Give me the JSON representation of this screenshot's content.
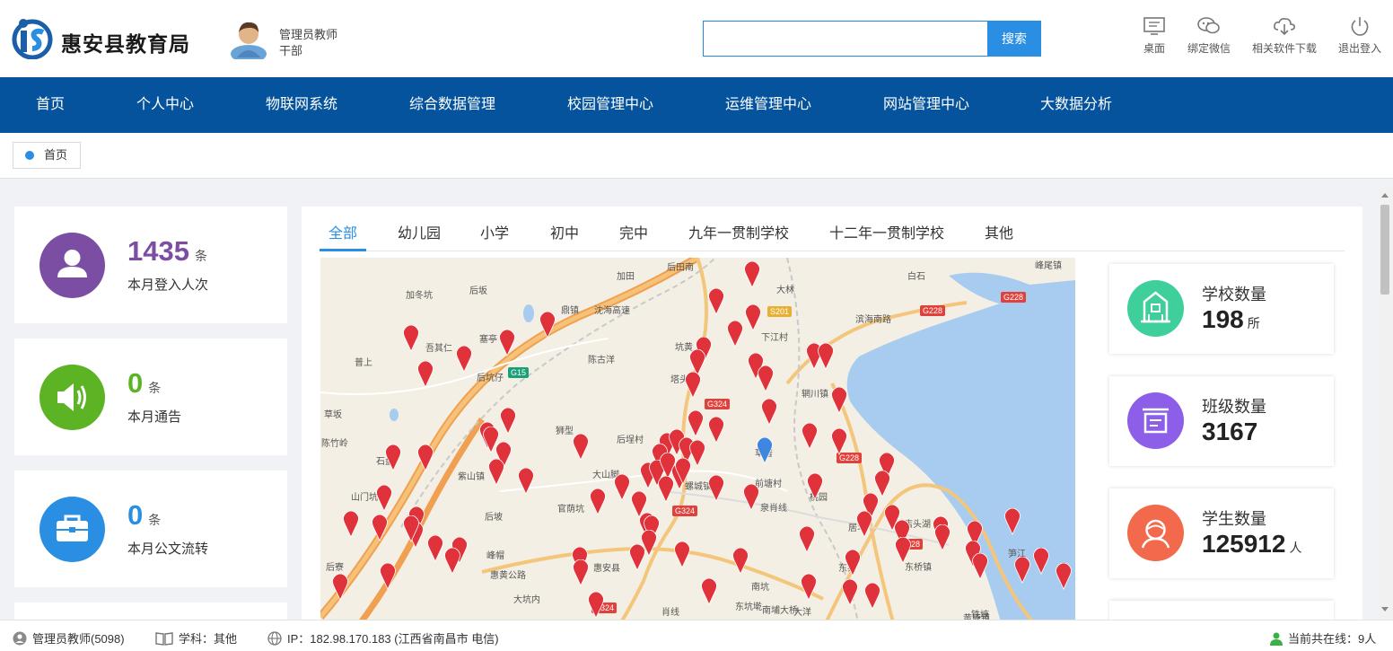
{
  "header": {
    "brand": "惠安县教育局",
    "user_role": "管理员教师",
    "user_dept": "干部",
    "search_placeholder": "",
    "search_button": "搜索",
    "tools": [
      "桌面",
      "绑定微信",
      "相关软件下载",
      "退出登入"
    ]
  },
  "nav": [
    "首页",
    "个人中心",
    "物联网系统",
    "综合数据管理",
    "校园管理中心",
    "运维管理中心",
    "网站管理中心",
    "大数据分析"
  ],
  "breadcrumb": "首页",
  "stats": [
    {
      "value": "1435",
      "unit": "条",
      "label": "本月登入人次",
      "color": "#7b4ea3"
    },
    {
      "value": "0",
      "unit": "条",
      "label": "本月通告",
      "color": "#5cb323"
    },
    {
      "value": "0",
      "unit": "条",
      "label": "本月公文流转",
      "color": "#2a8fe3"
    }
  ],
  "tabs": [
    "全部",
    "幼儿园",
    "小学",
    "初中",
    "完中",
    "九年一贯制学校",
    "十二年一贯制学校",
    "其他"
  ],
  "map": {
    "place_labels": [
      "加田",
      "后田南",
      "加冬坑",
      "后坂",
      "鼎镇",
      "大林",
      "白石",
      "峰尾镇",
      "沈海高速",
      "S201",
      "G228",
      "G228",
      "下江村",
      "吾其仁",
      "塞亭",
      "坑黄",
      "滨海南路",
      "普上",
      "后坑仔",
      "陈古洋",
      "塔头",
      "辋川镇",
      "G15",
      "G324",
      "草坂",
      "狮型",
      "陈竹岭",
      "后埕村",
      "石盘",
      "紫山镇",
      "草厝",
      "G228",
      "大山脚",
      "前塘村",
      "桃园",
      "螺城镇",
      "山门坑",
      "后坡",
      "官荫坑",
      "G324",
      "泉肖线",
      "居斗",
      "店头湖",
      "峰帽",
      "G228",
      "后寮",
      "东桥镇",
      "惠黄公路",
      "惠安县",
      "东察",
      "大坑内",
      "南埔大桥",
      "铁塘",
      "G324",
      "肖线",
      "笋江",
      "黄塘镇",
      "东坑墘",
      "大洋",
      "南坑"
    ]
  },
  "right_cards": [
    {
      "title": "学校数量",
      "value": "198",
      "unit": "所",
      "color": "#3fcf9a"
    },
    {
      "title": "班级数量",
      "value": "3167",
      "unit": "",
      "color": "#8d5fe8"
    },
    {
      "title": "学生数量",
      "value": "125912",
      "unit": "人",
      "color": "#f26a4b"
    }
  ],
  "footer": {
    "user": "管理员教师(5098)",
    "subject": "学科：其他",
    "ip": "IP：182.98.170.183 (江西省南昌市 电信)",
    "online": "当前共在线：9人"
  }
}
